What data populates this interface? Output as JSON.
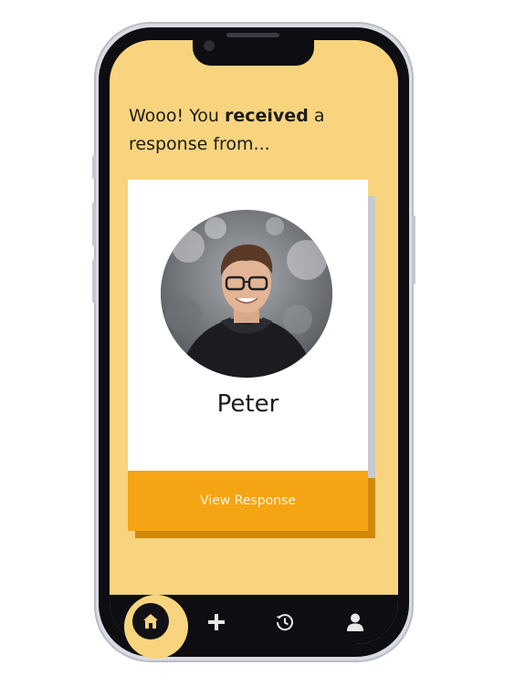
{
  "headline": {
    "prefix": "Wooo! You ",
    "emphasis": "received",
    "suffix": " a response from..."
  },
  "card": {
    "avatar_alt": "profile photo",
    "name": "Peter",
    "button_label": "View Response"
  },
  "bottom_nav": {
    "items": [
      {
        "name": "home",
        "icon": "home-icon",
        "active": true
      },
      {
        "name": "add",
        "icon": "plus-icon",
        "active": false
      },
      {
        "name": "history",
        "icon": "history-icon",
        "active": false
      },
      {
        "name": "profile",
        "icon": "user-icon",
        "active": false
      }
    ]
  },
  "colors": {
    "background": "#f8d47e",
    "accent": "#f5a414",
    "accent_shadow": "#d1890a",
    "frame": "#0d0d12"
  }
}
